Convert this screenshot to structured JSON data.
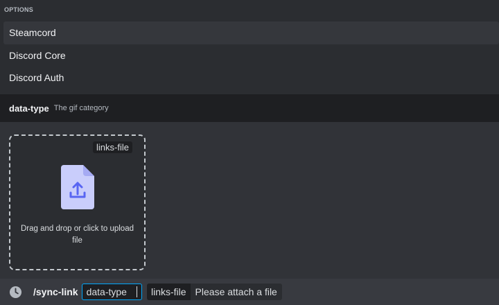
{
  "options": {
    "header": "OPTIONS",
    "items": [
      {
        "label": "Steamcord"
      },
      {
        "label": "Discord Core"
      },
      {
        "label": "Discord Auth"
      }
    ]
  },
  "field": {
    "name": "data-type",
    "description": "The gif category"
  },
  "upload": {
    "tag": "links-file",
    "text": "Drag and drop or click to upload file",
    "icon": "file-upload-icon"
  },
  "command": {
    "icon": "clock-icon",
    "name": "/sync-link",
    "active_param": "data-type",
    "file_param_name": "links-file",
    "file_param_value": "Please attach a file"
  },
  "colors": {
    "background": "#313338",
    "popup": "#2b2d31",
    "accent": "#00a8fc",
    "file_icon": "#c9cdfb"
  }
}
